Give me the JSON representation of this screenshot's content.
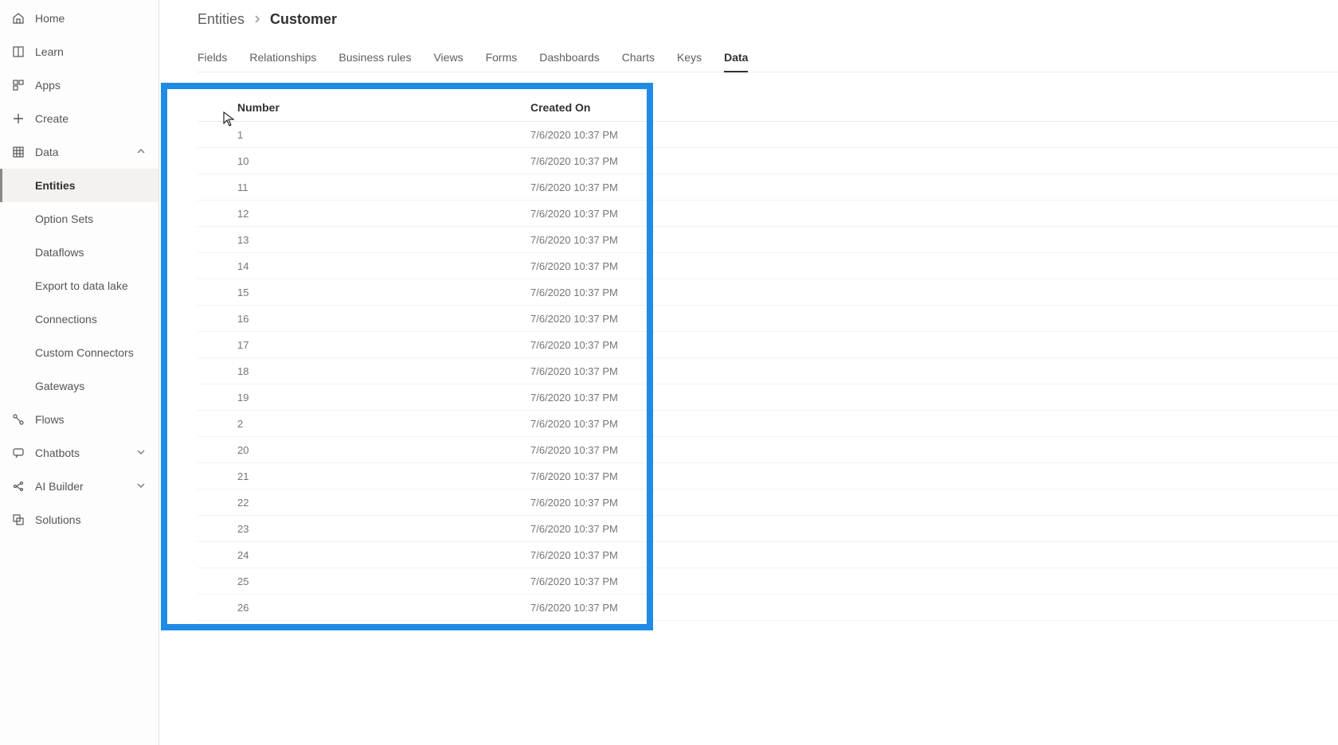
{
  "sidebar": {
    "items": [
      {
        "label": "Home",
        "icon": "home"
      },
      {
        "label": "Learn",
        "icon": "book"
      },
      {
        "label": "Apps",
        "icon": "apps"
      },
      {
        "label": "Create",
        "icon": "plus"
      }
    ],
    "data_group": {
      "label": "Data",
      "expanded": true,
      "children": [
        {
          "label": "Entities",
          "active": true
        },
        {
          "label": "Option Sets"
        },
        {
          "label": "Dataflows"
        },
        {
          "label": "Export to data lake"
        },
        {
          "label": "Connections"
        },
        {
          "label": "Custom Connectors"
        },
        {
          "label": "Gateways"
        }
      ]
    },
    "tail_items": [
      {
        "label": "Flows",
        "icon": "flow"
      },
      {
        "label": "Chatbots",
        "icon": "chat",
        "expandable": true
      },
      {
        "label": "AI Builder",
        "icon": "ai",
        "expandable": true
      },
      {
        "label": "Solutions",
        "icon": "solutions"
      }
    ]
  },
  "breadcrumb": {
    "parent": "Entities",
    "current": "Customer"
  },
  "tabs": [
    {
      "label": "Fields"
    },
    {
      "label": "Relationships"
    },
    {
      "label": "Business rules"
    },
    {
      "label": "Views"
    },
    {
      "label": "Forms"
    },
    {
      "label": "Dashboards"
    },
    {
      "label": "Charts"
    },
    {
      "label": "Keys"
    },
    {
      "label": "Data",
      "active": true
    }
  ],
  "table": {
    "columns": [
      "Number",
      "Created On"
    ],
    "rows": [
      {
        "number": "1",
        "created": "7/6/2020 10:37 PM"
      },
      {
        "number": "10",
        "created": "7/6/2020 10:37 PM"
      },
      {
        "number": "11",
        "created": "7/6/2020 10:37 PM"
      },
      {
        "number": "12",
        "created": "7/6/2020 10:37 PM"
      },
      {
        "number": "13",
        "created": "7/6/2020 10:37 PM"
      },
      {
        "number": "14",
        "created": "7/6/2020 10:37 PM"
      },
      {
        "number": "15",
        "created": "7/6/2020 10:37 PM"
      },
      {
        "number": "16",
        "created": "7/6/2020 10:37 PM"
      },
      {
        "number": "17",
        "created": "7/6/2020 10:37 PM"
      },
      {
        "number": "18",
        "created": "7/6/2020 10:37 PM"
      },
      {
        "number": "19",
        "created": "7/6/2020 10:37 PM"
      },
      {
        "number": "2",
        "created": "7/6/2020 10:37 PM"
      },
      {
        "number": "20",
        "created": "7/6/2020 10:37 PM"
      },
      {
        "number": "21",
        "created": "7/6/2020 10:37 PM"
      },
      {
        "number": "22",
        "created": "7/6/2020 10:37 PM"
      },
      {
        "number": "23",
        "created": "7/6/2020 10:37 PM"
      },
      {
        "number": "24",
        "created": "7/6/2020 10:37 PM"
      },
      {
        "number": "25",
        "created": "7/6/2020 10:37 PM"
      },
      {
        "number": "26",
        "created": "7/6/2020 10:37 PM"
      }
    ]
  }
}
